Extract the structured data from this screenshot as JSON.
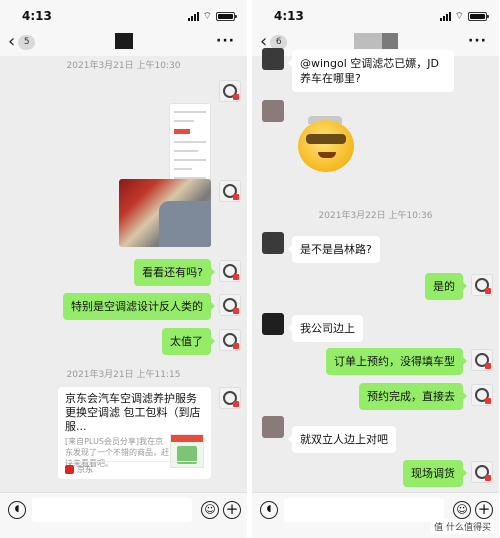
{
  "left": {
    "time": "4:13",
    "badge": "5",
    "timestamps": [
      "2021年3月21日 上午10:30",
      "2021年3月21日 上午11:15"
    ],
    "messages": [
      "看看还有吗?",
      "特别是空调滤设计反人类的",
      "太值了"
    ],
    "card": {
      "title": "京东会汽车空调滤养护服务 更换空调滤 包工包料（到店服...",
      "desc": "[来自PLUS会员分享]我在京东发现了一个不错的商品，赶快来看看吧。",
      "source": "京东"
    }
  },
  "right": {
    "time": "4:13",
    "badge": "6",
    "timestamps": [
      "2021年3月22日 上午10:36"
    ],
    "messages": [
      "@wingol 空调滤芯已嫖，JD养车在哪里?",
      "是不是昌林路?",
      "是的",
      "我公司边上",
      "订单上预约，没得填车型",
      "预约完成，直接去",
      "就双立人边上对吧",
      "现场调货"
    ]
  },
  "watermark": "值 什么值得买",
  "colors": {
    "outgoing_bubble": "#95ec69",
    "incoming_bubble": "#ffffff",
    "chat_bg": "#ededed"
  }
}
